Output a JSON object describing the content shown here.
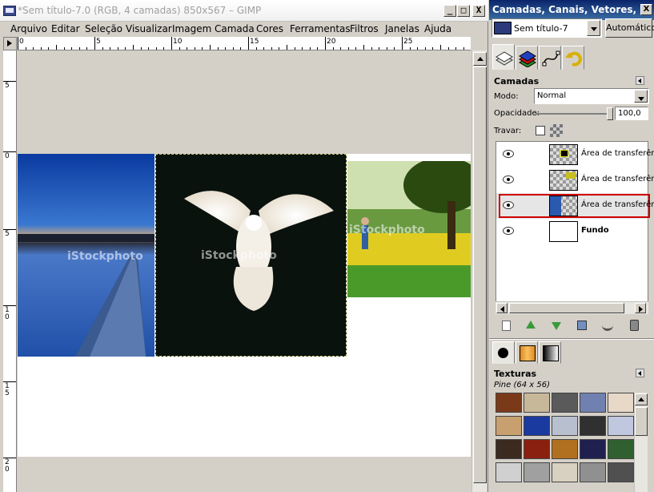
{
  "window": {
    "title": "*Sem título-7.0 (RGB, 4 camadas) 850x567 – GIMP",
    "buttons": {
      "minimize": "_",
      "maximize": "□",
      "close": "X"
    }
  },
  "menubar": [
    {
      "label": "Arquivo"
    },
    {
      "label": "Editar"
    },
    {
      "label": "Seleção"
    },
    {
      "label": "Visualizar"
    },
    {
      "label": "Imagem"
    },
    {
      "label": "Camada"
    },
    {
      "label": "Cores"
    },
    {
      "label": "Ferramentas"
    },
    {
      "label": "Filtros"
    },
    {
      "label": "Janelas"
    },
    {
      "label": "Ajuda"
    }
  ],
  "ruler": {
    "top_labels": [
      "0",
      "5",
      "10",
      "15",
      "20",
      "25"
    ],
    "left_labels": [
      "5",
      "0",
      "5",
      "1\n0",
      "1\n5",
      "2\n0"
    ]
  },
  "canvas": {
    "watermarks": [
      "iStockphoto",
      "iStockphoto",
      "iStockphoto"
    ]
  },
  "dock": {
    "title": "Camadas, Canais, Vetores, Desf…",
    "image_selector": "Sem título-7",
    "auto_button": "Automático",
    "layers_panel": {
      "title": "Camadas",
      "mode_label": "Modo:",
      "mode_value": "Normal",
      "opacity_label": "Opacidade:",
      "opacity_value": "100,0",
      "opacity_percent": 100,
      "lock_label": "Travar:",
      "layers": [
        {
          "name": "Área de transferência",
          "visible": true,
          "selected": false
        },
        {
          "name": "Área de transferência",
          "visible": true,
          "selected": false
        },
        {
          "name": "Área de transferência",
          "visible": true,
          "selected": true
        },
        {
          "name": "Fundo",
          "visible": true,
          "selected": false
        }
      ]
    },
    "textures_panel": {
      "title": "Texturas",
      "current": "Pine (64 x 56)",
      "swatches": [
        "#7a3a1a",
        "#c8b89a",
        "#5a5a5a",
        "#7080b0",
        "#e8d8c8",
        "#c8a070",
        "#1a3aa0",
        "#b8c0d0",
        "#303030",
        "#c0c8e0",
        "#3a2a20",
        "#8a2010",
        "#b07020",
        "#202050",
        "#306030",
        "#d0d0d0",
        "#a0a0a0",
        "#d8d0c0",
        "#909090",
        "#505050"
      ]
    },
    "colors": {
      "accent": "#0a246a",
      "highlight": "#d00000"
    }
  }
}
